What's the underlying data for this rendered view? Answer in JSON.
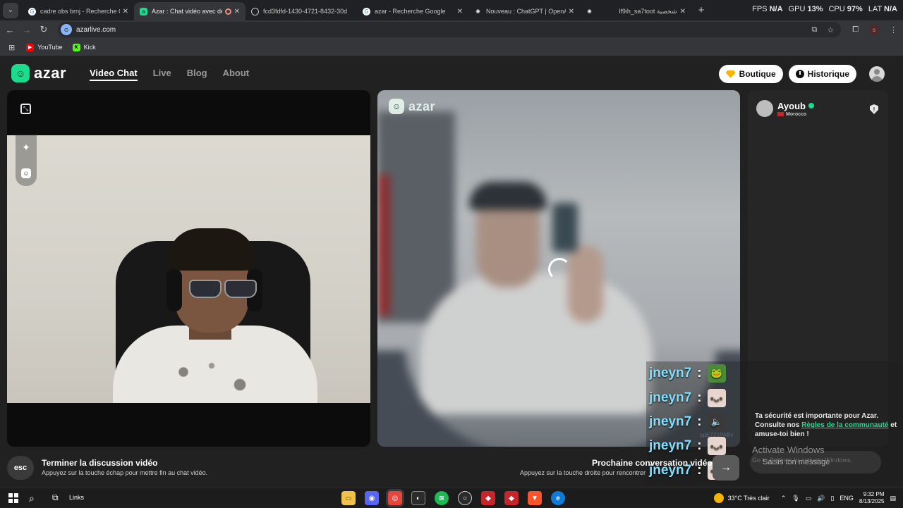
{
  "browser": {
    "tabs": [
      {
        "title": "cadre obs brnj - Recherche Goo",
        "icon": "google-icon",
        "active": false
      },
      {
        "title": "Azar : Chat vidéo avec de n",
        "icon": "azar-icon",
        "active": true
      },
      {
        "title": "fcd3fdfd-1430-4721-8432-30d",
        "icon": "globe-icon",
        "active": false
      },
      {
        "title": "azar - Recherche Google",
        "icon": "google-icon",
        "active": false
      },
      {
        "title": "Nouveau : ChatGPT | OpenAI",
        "icon": "openai-icon",
        "active": false
      },
      {
        "title": "lf9ih_sa7toot شخصية",
        "icon": "openai-icon",
        "active": false
      }
    ],
    "stats": {
      "fps_label": "FPS",
      "fps_value": "N/A",
      "gpu_label": "GPU",
      "gpu_value": "13",
      "cpu_label": "CPU",
      "cpu_value": "97",
      "lat_label": "LAT",
      "lat_value": "N/A"
    },
    "url": "azarlive.com",
    "profile_initial": "s",
    "bookmarks": [
      {
        "label": "YouTube"
      },
      {
        "label": "Kick"
      }
    ]
  },
  "site": {
    "logo_text": "azar",
    "nav": [
      {
        "label": "Video Chat",
        "active": true
      },
      {
        "label": "Live",
        "active": false
      },
      {
        "label": "Blog",
        "active": false
      },
      {
        "label": "About",
        "active": false
      }
    ],
    "shop_label": "Boutique",
    "history_label": "Historique"
  },
  "partner": {
    "name": "Ayoub",
    "country": "Morocco"
  },
  "safety": {
    "text_before": "Ta sécurité est importante pour Azar. Consulte nos ",
    "link": "Règles de la communauté",
    "text_after": " et amuse-toi bien !"
  },
  "message_placeholder": "Saisis ton message",
  "watermark": {
    "title": "Activate Windows",
    "subtitle": "Go to Settings to activate Windows."
  },
  "faint_text": "ppE7Z1PABv",
  "chat_overlay": [
    {
      "user": "jneyn7",
      "sep": ":",
      "emote": "frog-emote"
    },
    {
      "user": "jneyn7",
      "sep": ":",
      "emote": "face-emote"
    },
    {
      "user": "jneyn7",
      "sep": ":",
      "emote": "speaker-emote"
    },
    {
      "user": "jneyn7",
      "sep": ":",
      "emote": "face-emote"
    },
    {
      "user": "jneyn7",
      "sep": ":",
      "emote": "face-emote"
    }
  ],
  "footer": {
    "esc_label": "esc",
    "end_title": "Terminer la discussion vidéo",
    "end_sub": "Appuyez sur la touche échap pour mettre fin au chat vidéo.",
    "next_title": "Prochaine conversation vidéo",
    "next_sub": "Appuyez sur la touche droite pour rencontrer quelqu'un de nouveau."
  },
  "taskbar": {
    "links_label": "Links",
    "weather": "33°C  Très clair",
    "lang": "ENG",
    "time": "9:32 PM",
    "date": "8/13/2025"
  },
  "colors": {
    "brand": "#1bdc8c",
    "chat_name": "#7fe0ff"
  }
}
